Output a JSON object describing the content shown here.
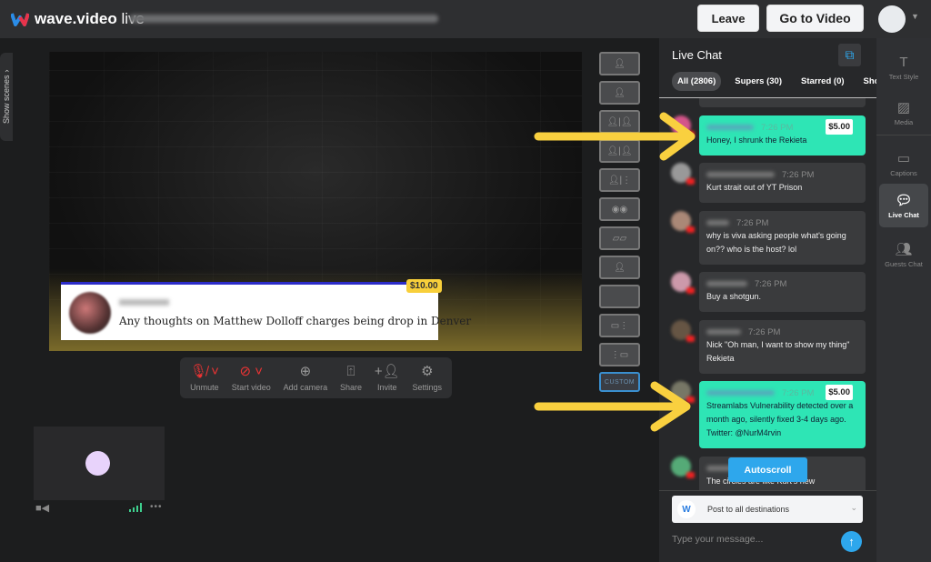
{
  "app": {
    "logo_text": "wave.video",
    "logo_suffix": "live",
    "header_buttons": {
      "leave": "Leave",
      "go_to_video": "Go to Video"
    }
  },
  "scenes_tab": "Show scenes",
  "stage": {
    "comment": {
      "text": "Any thoughts on Matthew Dolloff charges being drop in Denver",
      "tip": "$10.00"
    }
  },
  "controls": [
    {
      "label": "Unmute",
      "icon": "mic-off-icon"
    },
    {
      "label": "Start video",
      "icon": "video-off-icon"
    },
    {
      "label": "Add camera",
      "icon": "plus-circle-icon"
    },
    {
      "label": "Share",
      "icon": "share-screen-icon"
    },
    {
      "label": "Invite",
      "icon": "add-user-icon"
    },
    {
      "label": "Settings",
      "icon": "gear-icon"
    }
  ],
  "layouts": {
    "custom_label": "CUSTOM"
  },
  "chat": {
    "title": "Live Chat",
    "tabs": [
      "All (2806)",
      "Supers (30)",
      "Starred (0)",
      "Shown"
    ],
    "messages": [
      {
        "time": "7:26 PM",
        "text": "Honey, I shrunk the Rekieta",
        "tip": "$5.00",
        "super": true
      },
      {
        "time": "7:26 PM",
        "text": "Kurt strait out of YT Prison"
      },
      {
        "time": "7:26 PM",
        "text": "why is viva asking people what's going on?? who is the host? lol"
      },
      {
        "time": "7:26 PM",
        "text": "Buy a shotgun."
      },
      {
        "time": "7:26 PM",
        "text": "Nick \"Oh man, I want to show my thing\" Rekieta"
      },
      {
        "time": "7:26 PM",
        "text": "Streamlabs Vulnerability detected over a month ago, silently fixed 3-4 days ago. Twitter: @NurM4rvin",
        "tip": "$5.00",
        "super": true
      },
      {
        "time": "",
        "text": "The circles are like Kurt's new"
      }
    ],
    "autoscroll": "Autoscroll",
    "destination": "Post to all destinations",
    "input_placeholder": "Type your message..."
  },
  "right_tools": [
    {
      "label": "Text Style",
      "icon": "text-icon"
    },
    {
      "label": "Media",
      "icon": "image-icon"
    },
    {
      "label": "Captions",
      "icon": "captions-icon"
    },
    {
      "label": "Live Chat",
      "icon": "chat-icon",
      "active": true
    },
    {
      "label": "Guests Chat",
      "icon": "guests-icon"
    }
  ],
  "colors": {
    "accent": "#2ea7ec",
    "super_chat": "#2ee5b5",
    "tip_yellow": "#f8cf3a",
    "annotation_arrow": "#f9d03f"
  }
}
